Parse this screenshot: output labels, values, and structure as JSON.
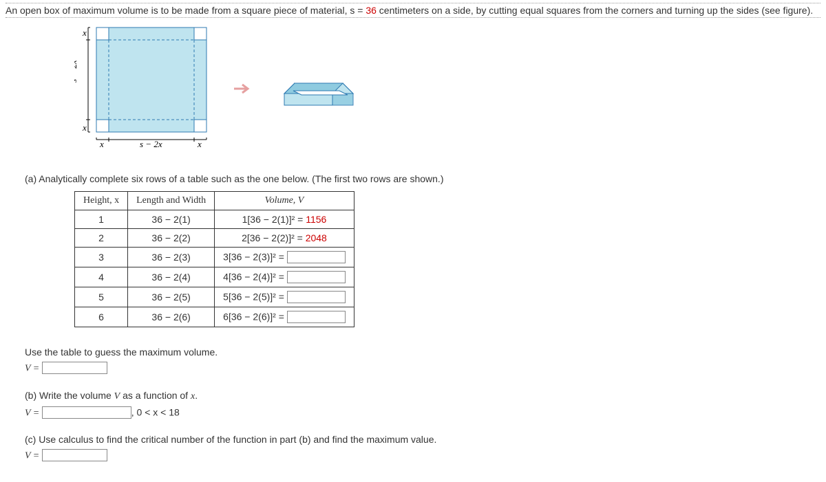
{
  "intro": {
    "pre": "An open box of maximum volume is to be made from a square piece of material, s = ",
    "s": "36",
    "post": " centimeters on a side, by cutting equal squares from the corners and turning up the sides (see figure)."
  },
  "figure": {
    "x": "x",
    "s2x": "s − 2x"
  },
  "partA": {
    "text": "(a) Analytically complete six rows of a table such as the one below. (The first two rows are shown.)",
    "headers": {
      "h1": "Height, x",
      "h2": "Length and Width",
      "h3": "Volume, V"
    },
    "rows": [
      {
        "h": "1",
        "lw": "36 − 2(1)",
        "vol_expr": "1[36 − 2(1)]² = ",
        "vol_val": "1156",
        "input": false
      },
      {
        "h": "2",
        "lw": "36 − 2(2)",
        "vol_expr": "2[36 − 2(2)]² = ",
        "vol_val": "2048",
        "input": false
      },
      {
        "h": "3",
        "lw": "36 − 2(3)",
        "vol_expr": "3[36 − 2(3)]² = ",
        "input": true
      },
      {
        "h": "4",
        "lw": "36 − 2(4)",
        "vol_expr": "4[36 − 2(4)]² = ",
        "input": true
      },
      {
        "h": "5",
        "lw": "36 − 2(5)",
        "vol_expr": "5[36 − 2(5)]² = ",
        "input": true
      },
      {
        "h": "6",
        "lw": "36 − 2(6)",
        "vol_expr": "6[36 − 2(6)]² = ",
        "input": true
      }
    ]
  },
  "guess": {
    "text": "Use the table to guess the maximum volume.",
    "lhs": "V = "
  },
  "partB": {
    "text": "(b) Write the volume V as a function of x.",
    "lhs": "V = ",
    "domain": ",     0 < x < 18"
  },
  "partC": {
    "text": "(c) Use calculus to find the critical number of the function in part (b) and find the maximum value.",
    "lhs": "V = "
  }
}
